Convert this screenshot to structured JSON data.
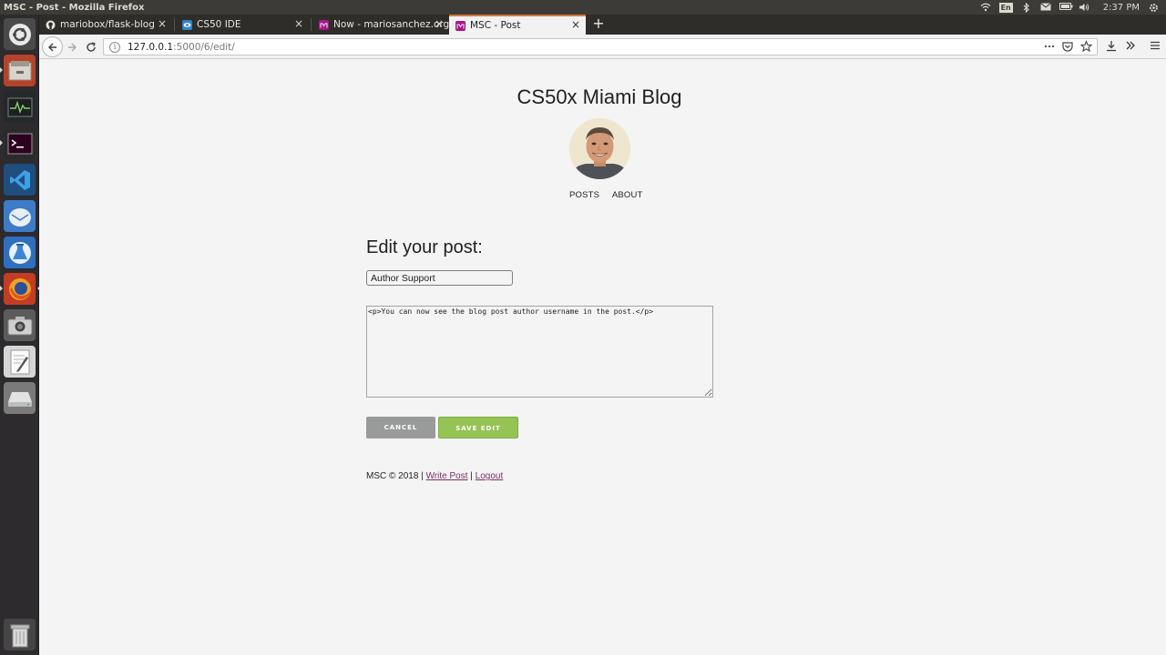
{
  "system": {
    "window_title": "MSC - Post - Mozilla Firefox",
    "clock": "2:37 PM",
    "keyboard_layout": "En"
  },
  "launcher": {
    "apps": [
      "ubuntu-dash-icon",
      "files-icon",
      "system-monitor-icon",
      "terminal-icon",
      "vscode-icon",
      "mail-icon",
      "flask-icon",
      "firefox-icon",
      "screenshot-icon",
      "text-editor-icon",
      "drive-icon",
      "trash-icon"
    ]
  },
  "browser": {
    "tabs": [
      {
        "label": "mariobox/flask-blog",
        "close": "×"
      },
      {
        "label": "CS50 IDE",
        "close": "×"
      },
      {
        "label": "Now - mariosanchez.org",
        "close": "×"
      },
      {
        "label": "MSC - Post",
        "close": "×"
      }
    ],
    "new_tab": "+",
    "url_host": "127.0.0.1",
    "url_rest": ":5000/6/edit/"
  },
  "page": {
    "blog_title": "CS50x Miami Blog",
    "nav": {
      "posts": "POSTS",
      "about": "ABOUT"
    },
    "heading": "Edit your post:",
    "title_value": "Author Support",
    "body_value": "<p>You can now see the blog post author username in the post.</p>",
    "cancel_label": "CANCEL",
    "save_label": "SAVE EDIT",
    "footer": {
      "copyright": "MSC © 2018 |",
      "write_post": "Write Post",
      "separator": "|",
      "logout": "Logout"
    }
  },
  "colors": {
    "tab_accent": "#d5793a",
    "save_button": "#95c354",
    "cancel_button": "#999a9a",
    "link": "#7a2f63"
  }
}
